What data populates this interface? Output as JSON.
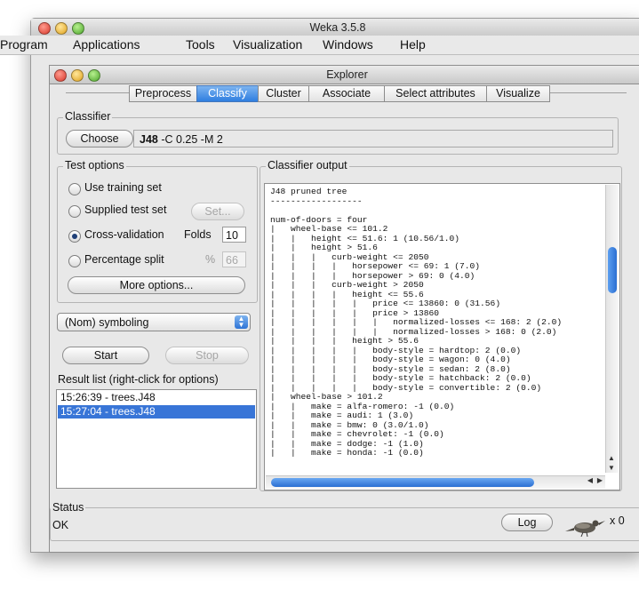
{
  "outer_window": {
    "title": "Weka 3.5.8"
  },
  "menubar": {
    "items": [
      "Program",
      "Applications",
      "Tools",
      "Visualization",
      "Windows",
      "Help"
    ]
  },
  "explorer_window": {
    "title": "Explorer"
  },
  "tabs": [
    "Preprocess",
    "Classify",
    "Cluster",
    "Associate",
    "Select attributes",
    "Visualize"
  ],
  "selected_tab": "Classify",
  "classifier": {
    "legend": "Classifier",
    "choose_label": "Choose",
    "name": "J48",
    "options": "-C 0.25 -M 2"
  },
  "test_options": {
    "legend": "Test options",
    "use_training_set": "Use training set",
    "supplied_test_set": "Supplied test set",
    "set_label": "Set...",
    "cross_validation": "Cross-validation",
    "folds_label": "Folds",
    "folds_value": "10",
    "percentage_split": "Percentage split",
    "percent_symbol": "%",
    "percent_value": "66",
    "more_options": "More options...",
    "selected": "cross_validation"
  },
  "class_selector": {
    "value": "(Nom) symboling"
  },
  "actions": {
    "start": "Start",
    "stop": "Stop"
  },
  "result_list": {
    "legend": "Result list (right-click for options)",
    "items": [
      "15:26:39 - trees.J48",
      "15:27:04 - trees.J48"
    ],
    "selected_index": 1
  },
  "classifier_output": {
    "legend": "Classifier output",
    "lines": [
      "J48 pruned tree",
      "------------------",
      "",
      "num-of-doors = four",
      "|   wheel-base <= 101.2",
      "|   |   height <= 51.6: 1 (10.56/1.0)",
      "|   |   height > 51.6",
      "|   |   |   curb-weight <= 2050",
      "|   |   |   |   horsepower <= 69: 1 (7.0)",
      "|   |   |   |   horsepower > 69: 0 (4.0)",
      "|   |   |   curb-weight > 2050",
      "|   |   |   |   height <= 55.6",
      "|   |   |   |   |   price <= 13860: 0 (31.56)",
      "|   |   |   |   |   price > 13860",
      "|   |   |   |   |   |   normalized-losses <= 168: 2 (2.0)",
      "|   |   |   |   |   |   normalized-losses > 168: 0 (2.0)",
      "|   |   |   |   height > 55.6",
      "|   |   |   |   |   body-style = hardtop: 2 (0.0)",
      "|   |   |   |   |   body-style = wagon: 0 (4.0)",
      "|   |   |   |   |   body-style = sedan: 2 (8.0)",
      "|   |   |   |   |   body-style = hatchback: 2 (0.0)",
      "|   |   |   |   |   body-style = convertible: 2 (0.0)",
      "|   wheel-base > 101.2",
      "|   |   make = alfa-romero: -1 (0.0)",
      "|   |   make = audi: 1 (3.0)",
      "|   |   make = bmw: 0 (3.0/1.0)",
      "|   |   make = chevrolet: -1 (0.0)",
      "|   |   make = dodge: -1 (1.0)",
      "|   |   make = honda: -1 (0.0)"
    ]
  },
  "status": {
    "legend": "Status",
    "text": "OK",
    "log_label": "Log",
    "task_count": "x 0"
  }
}
